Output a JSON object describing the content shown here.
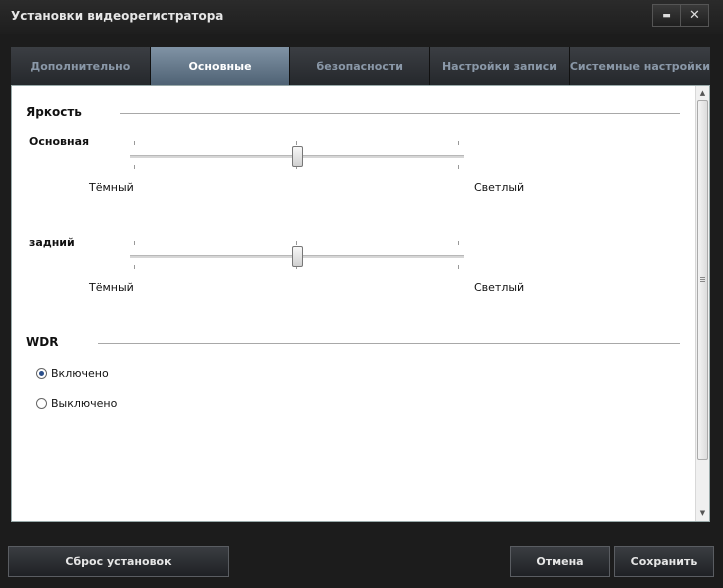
{
  "window": {
    "title": "Установки видеорегистратора",
    "minimize_symbol": "▬",
    "close_symbol": "✕"
  },
  "tabs": [
    {
      "label": "Дополнительно",
      "active": false
    },
    {
      "label": "Основные",
      "active": true
    },
    {
      "label": "безопасности",
      "active": false
    },
    {
      "label": "Настройки записи",
      "active": false
    },
    {
      "label": "Системные настройки",
      "active": false
    }
  ],
  "brightness": {
    "title": "Яркость",
    "main": {
      "label": "Основная",
      "min_label": "Тёмный",
      "max_label": "Светлый",
      "value": 0.5
    },
    "back": {
      "label": "задний",
      "min_label": "Тёмный",
      "max_label": "Светлый",
      "value": 0.5
    }
  },
  "wdr": {
    "title": "WDR",
    "options": [
      {
        "label": "Включено",
        "checked": true
      },
      {
        "label": "Выключено",
        "checked": false
      }
    ]
  },
  "buttons": {
    "reset": "Сброс установок",
    "cancel": "Отмена",
    "save": "Сохранить"
  },
  "scrollbar": {
    "up_arrow": "▲",
    "down_arrow": "▼"
  }
}
